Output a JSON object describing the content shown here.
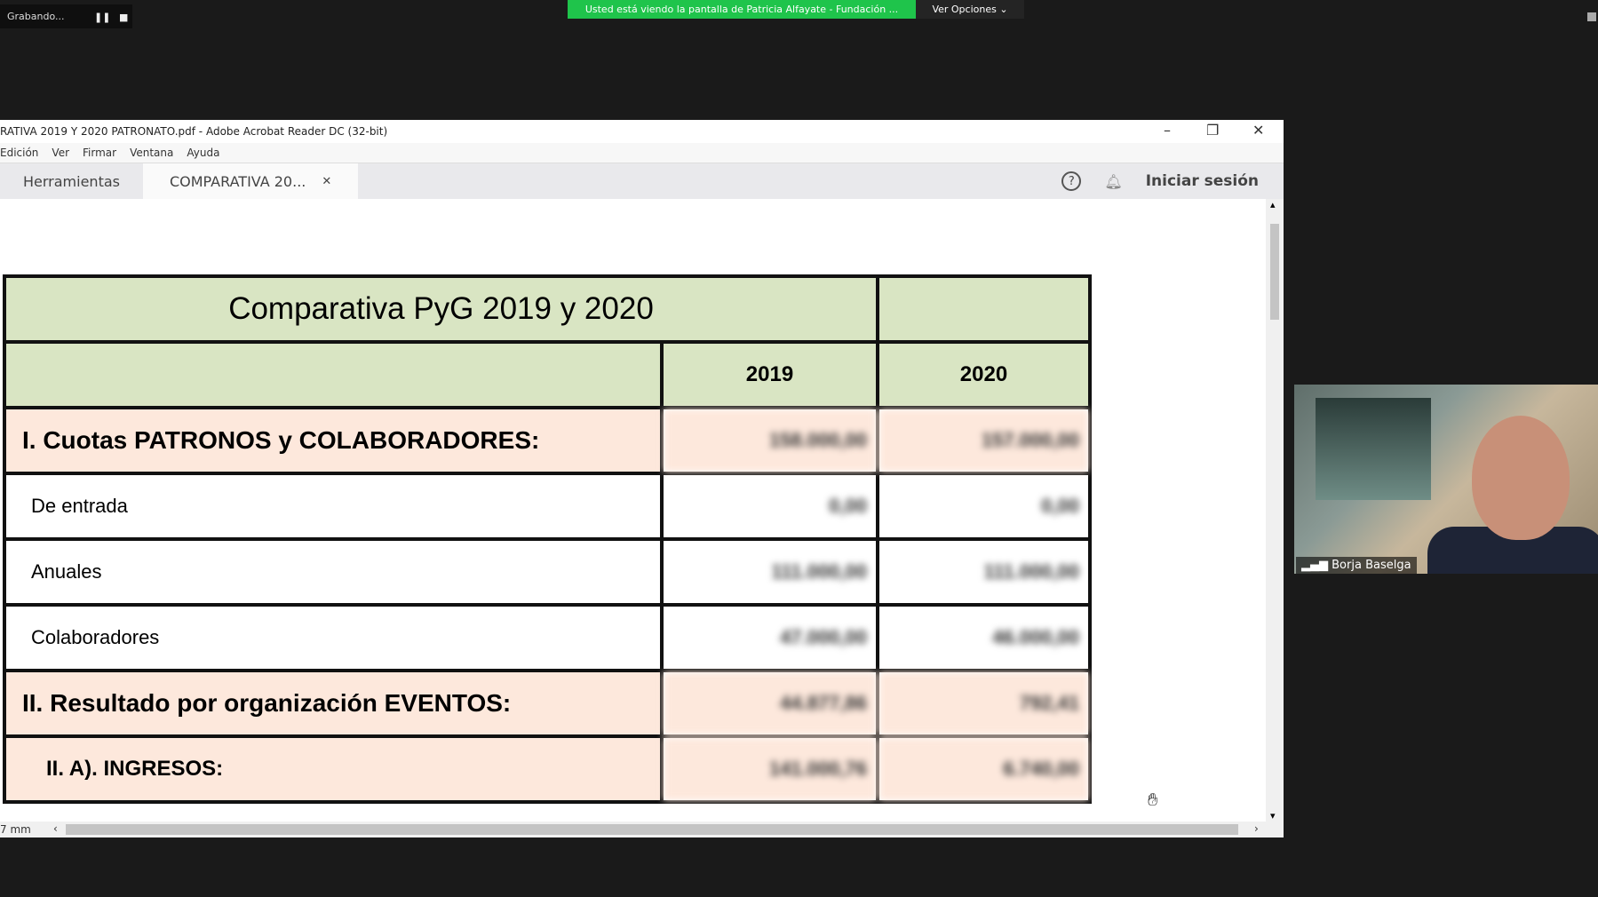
{
  "zoom": {
    "recording_label": "Grabando...",
    "pause_icon": "pause",
    "stop_icon": "stop",
    "banner": "Usted está viendo la pantalla de Patricia Alfayate - Fundación ...",
    "view_options": "Ver Opciones",
    "participant": "Borja Baselga"
  },
  "acrobat": {
    "title": "RATIVA 2019 Y 2020 PATRONATO.pdf - Adobe Acrobat Reader DC (32-bit)",
    "menu": [
      "Edición",
      "Ver",
      "Firmar",
      "Ventana",
      "Ayuda"
    ],
    "tabs": {
      "tools": "Herramientas",
      "document": "COMPARATIVA 20..."
    },
    "sign_in": "Iniciar sesión",
    "page_size": "7 mm"
  },
  "table": {
    "title": "Comparativa PyG 2019 y 2020",
    "years": [
      "2019",
      "2020"
    ],
    "rows": [
      {
        "label": "I. Cuotas PATRONOS y COLABORADORES:",
        "type": "section",
        "v2019": "158.000,00",
        "v2020": "157.000,00"
      },
      {
        "label": "De entrada",
        "type": "sub",
        "v2019": "0,00",
        "v2020": "0,00"
      },
      {
        "label": "Anuales",
        "type": "sub",
        "v2019": "111.000,00",
        "v2020": "111.000,00"
      },
      {
        "label": "Colaboradores",
        "type": "sub",
        "v2019": "47.000,00",
        "v2020": "46.000,00"
      },
      {
        "label": "II. Resultado por organización EVENTOS:",
        "type": "section",
        "v2019": "44.877,86",
        "v2020": "792,41"
      },
      {
        "label": "II. A). INGRESOS:",
        "type": "section2",
        "v2019": "141.000,76",
        "v2020": "6.740,00"
      }
    ]
  },
  "colors": {
    "banner": "#1fc44b",
    "header_fill": "#d9e5c3",
    "section_fill": "#fde8dc"
  }
}
